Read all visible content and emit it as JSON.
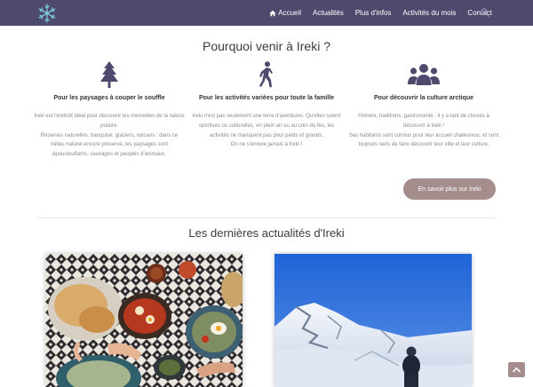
{
  "nav": {
    "items": [
      {
        "label": "Accueil",
        "icon": "home-icon"
      },
      {
        "label": "Actualités"
      },
      {
        "label": "Plus d'infos"
      },
      {
        "label": "Activités du mois"
      },
      {
        "label": "Contact"
      }
    ],
    "search_icon": "search-icon",
    "logo_icon": "snowflake-logo-icon",
    "background": "#4d4a6e"
  },
  "why": {
    "title": "Pourquoi venir à Ireki ?",
    "features": [
      {
        "icon": "tree-icon",
        "title": "Pour les paysages à couper le souffle",
        "body": [
          "Ireki est l'endroit idéal pour découvrir les merveilles de la nature polaire.",
          "Réserves naturelles, banquise, glaciers, volcans : dans ce milieu naturel encore préservé, les paysages sont époustouflants, sauvages et peuplés d'animaux."
        ]
      },
      {
        "icon": "walking-person-icon",
        "title": "Pour les activités variées pour toute la famille",
        "body": [
          "Ireki n'est pas seulement une terre d'aventures. Qu'elles soient sportives ou culturelles, en plein air ou au coin du feu, les activités ne manquent pas pour petits et grands.",
          "On ne s'ennuie jamais à Ireki !"
        ]
      },
      {
        "icon": "people-group-icon",
        "title": "Pour découvrir la culture arctique",
        "body": [
          "Histoire, traditions, gastronomie : il y a tant de choses à découvrir à Ireki !",
          "Ses habitants sont connus pour leur accueil chaleureux, et sont toujours ravis de faire découvrir leur ville et leur culture."
        ]
      }
    ],
    "cta": "En savoir plus sur Ireki",
    "accent": "#a58d8d",
    "icon_color": "#4d4a6e"
  },
  "news": {
    "title": "Les dernières actualités d'Ireki",
    "cards": [
      {
        "image": "food-table-photo"
      },
      {
        "image": "snowy-mountain-photo"
      }
    ]
  },
  "back_to_top_icon": "chevron-up-icon"
}
